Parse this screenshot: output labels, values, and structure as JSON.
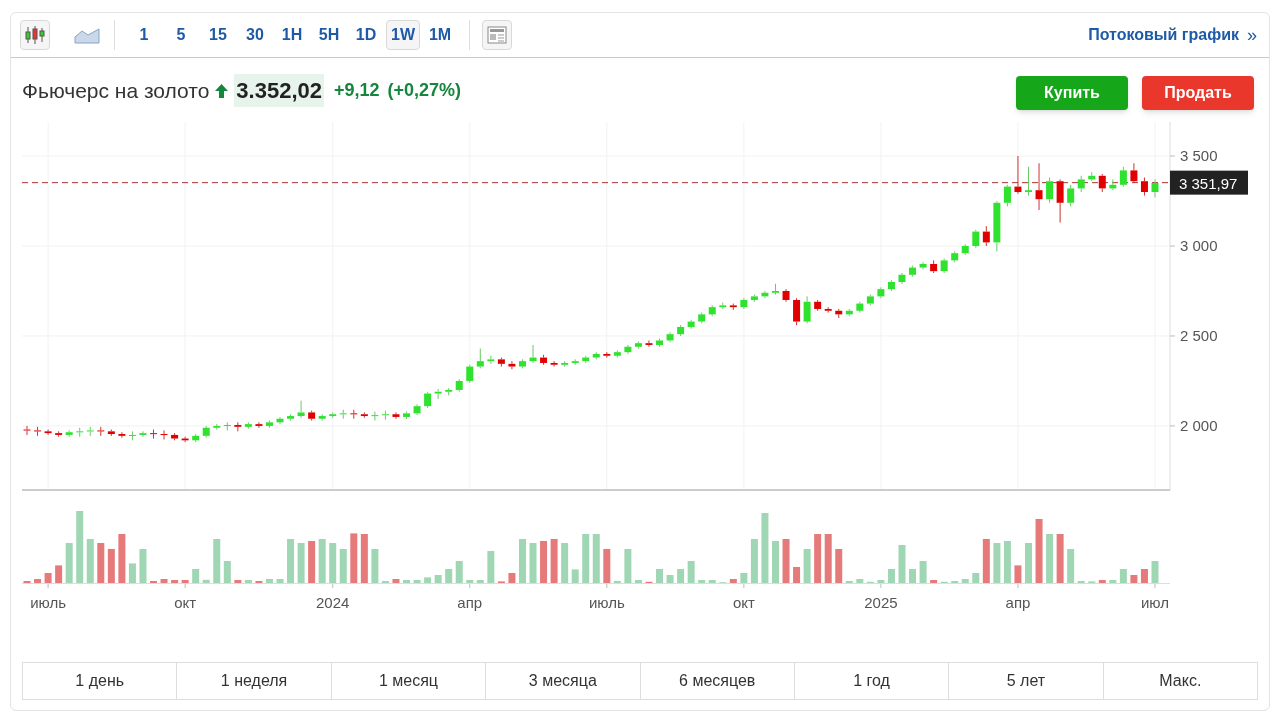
{
  "toolbar": {
    "chart_types": [
      {
        "kind": "candles",
        "selected": true
      },
      {
        "kind": "area",
        "selected": false
      }
    ],
    "intervals": [
      {
        "label": "1",
        "selected": false
      },
      {
        "label": "5",
        "selected": false
      },
      {
        "label": "15",
        "selected": false
      },
      {
        "label": "30",
        "selected": false
      },
      {
        "label": "1H",
        "selected": false
      },
      {
        "label": "5H",
        "selected": false
      },
      {
        "label": "1D",
        "selected": false
      },
      {
        "label": "1W",
        "selected": true
      },
      {
        "label": "1M",
        "selected": false
      }
    ],
    "streaming_link": {
      "label": "Потоковый график",
      "chevron": "»"
    }
  },
  "quote": {
    "name": "Фьючерс на золото",
    "rising": true,
    "price": "3.352,02",
    "change": "+9,12",
    "change_pct": "(+0,27%)"
  },
  "actions": [
    {
      "kind": "buy",
      "label": "Купить"
    },
    {
      "kind": "sell",
      "label": "Продать"
    }
  ],
  "chart": {
    "chart_data": {
      "type": "candlestick",
      "grid": true,
      "ylim": [
        1644,
        3689
      ],
      "yticks": [
        {
          "value": 2000,
          "label": "2 000"
        },
        {
          "value": 2500,
          "label": "2 500"
        },
        {
          "value": 3000,
          "label": "3 000"
        },
        {
          "value": 3500,
          "label": "3 500"
        }
      ],
      "categories": [
        null,
        null,
        "июль",
        null,
        null,
        null,
        null,
        null,
        null,
        null,
        null,
        null,
        null,
        null,
        null,
        "окт",
        null,
        null,
        null,
        null,
        null,
        null,
        null,
        null,
        null,
        null,
        null,
        null,
        null,
        "2024",
        null,
        null,
        null,
        null,
        null,
        null,
        null,
        null,
        null,
        null,
        null,
        null,
        "апр",
        null,
        null,
        null,
        null,
        null,
        null,
        null,
        null,
        null,
        null,
        null,
        null,
        "июль",
        null,
        null,
        null,
        null,
        null,
        null,
        null,
        null,
        null,
        null,
        null,
        null,
        "окт",
        null,
        null,
        null,
        null,
        null,
        null,
        null,
        null,
        null,
        null,
        null,
        null,
        "2025",
        null,
        null,
        null,
        null,
        null,
        null,
        null,
        null,
        null,
        null,
        null,
        null,
        "апр",
        null,
        null,
        null,
        null,
        null,
        null,
        null,
        null,
        null,
        null,
        null,
        null,
        "июл"
      ],
      "ref_lines": [
        {
          "axis": "y",
          "value": 3351.97,
          "color": "#aa3333",
          "label": "3 351,97"
        }
      ],
      "ohlc": [
        [
          1980,
          2000,
          1950,
          1975
        ],
        [
          1975,
          1995,
          1945,
          1970
        ],
        [
          1970,
          1980,
          1950,
          1960
        ],
        [
          1960,
          1970,
          1940,
          1950
        ],
        [
          1950,
          1975,
          1940,
          1965
        ],
        [
          1965,
          1990,
          1940,
          1970
        ],
        [
          1970,
          1995,
          1945,
          1975
        ],
        [
          1975,
          1995,
          1945,
          1970
        ],
        [
          1970,
          1980,
          1945,
          1955
        ],
        [
          1955,
          1965,
          1935,
          1945
        ],
        [
          1945,
          1970,
          1920,
          1950
        ],
        [
          1950,
          1970,
          1940,
          1960
        ],
        [
          1960,
          1980,
          1930,
          1955
        ],
        [
          1955,
          1975,
          1925,
          1950
        ],
        [
          1950,
          1960,
          1920,
          1930
        ],
        [
          1930,
          1940,
          1910,
          1920
        ],
        [
          1920,
          1955,
          1910,
          1945
        ],
        [
          1945,
          2000,
          1935,
          1990
        ],
        [
          1990,
          2010,
          1980,
          2000
        ],
        [
          2000,
          2020,
          1975,
          2005
        ],
        [
          2005,
          2020,
          1970,
          1995
        ],
        [
          1995,
          2020,
          1985,
          2010
        ],
        [
          2010,
          2020,
          1990,
          2000
        ],
        [
          2000,
          2030,
          1990,
          2020
        ],
        [
          2020,
          2050,
          2010,
          2040
        ],
        [
          2040,
          2065,
          2030,
          2055
        ],
        [
          2055,
          2140,
          2045,
          2075
        ],
        [
          2075,
          2085,
          2030,
          2040
        ],
        [
          2040,
          2065,
          2030,
          2055
        ],
        [
          2055,
          2075,
          2045,
          2065
        ],
        [
          2065,
          2090,
          2040,
          2070
        ],
        [
          2070,
          2090,
          2040,
          2065
        ],
        [
          2065,
          2075,
          2045,
          2055
        ],
        [
          2055,
          2080,
          2030,
          2060
        ],
        [
          2060,
          2085,
          2035,
          2065
        ],
        [
          2065,
          2075,
          2040,
          2050
        ],
        [
          2050,
          2080,
          2040,
          2070
        ],
        [
          2070,
          2120,
          2060,
          2110
        ],
        [
          2110,
          2190,
          2100,
          2180
        ],
        [
          2180,
          2205,
          2150,
          2190
        ],
        [
          2190,
          2210,
          2170,
          2200
        ],
        [
          2200,
          2260,
          2190,
          2250
        ],
        [
          2250,
          2340,
          2240,
          2330
        ],
        [
          2330,
          2430,
          2320,
          2360
        ],
        [
          2360,
          2390,
          2345,
          2370
        ],
        [
          2370,
          2380,
          2330,
          2345
        ],
        [
          2345,
          2360,
          2315,
          2330
        ],
        [
          2330,
          2370,
          2320,
          2360
        ],
        [
          2360,
          2450,
          2350,
          2380
        ],
        [
          2380,
          2395,
          2340,
          2350
        ],
        [
          2350,
          2360,
          2330,
          2340
        ],
        [
          2340,
          2360,
          2330,
          2350
        ],
        [
          2350,
          2370,
          2340,
          2360
        ],
        [
          2360,
          2390,
          2350,
          2380
        ],
        [
          2380,
          2410,
          2370,
          2400
        ],
        [
          2400,
          2410,
          2380,
          2390
        ],
        [
          2390,
          2420,
          2380,
          2410
        ],
        [
          2410,
          2450,
          2400,
          2440
        ],
        [
          2440,
          2470,
          2430,
          2460
        ],
        [
          2460,
          2475,
          2440,
          2450
        ],
        [
          2450,
          2485,
          2440,
          2475
        ],
        [
          2475,
          2520,
          2465,
          2510
        ],
        [
          2510,
          2560,
          2500,
          2550
        ],
        [
          2550,
          2590,
          2540,
          2580
        ],
        [
          2580,
          2630,
          2570,
          2620
        ],
        [
          2620,
          2670,
          2610,
          2660
        ],
        [
          2660,
          2685,
          2650,
          2670
        ],
        [
          2670,
          2680,
          2645,
          2660
        ],
        [
          2660,
          2710,
          2650,
          2700
        ],
        [
          2700,
          2730,
          2690,
          2720
        ],
        [
          2720,
          2750,
          2710,
          2740
        ],
        [
          2740,
          2790,
          2730,
          2750
        ],
        [
          2750,
          2760,
          2690,
          2700
        ],
        [
          2700,
          2710,
          2560,
          2580
        ],
        [
          2580,
          2720,
          2570,
          2690
        ],
        [
          2690,
          2700,
          2640,
          2650
        ],
        [
          2650,
          2660,
          2630,
          2640
        ],
        [
          2640,
          2650,
          2600,
          2620
        ],
        [
          2620,
          2650,
          2610,
          2640
        ],
        [
          2640,
          2690,
          2630,
          2680
        ],
        [
          2680,
          2730,
          2670,
          2720
        ],
        [
          2720,
          2770,
          2710,
          2760
        ],
        [
          2760,
          2810,
          2750,
          2800
        ],
        [
          2800,
          2850,
          2790,
          2840
        ],
        [
          2840,
          2890,
          2830,
          2880
        ],
        [
          2880,
          2910,
          2870,
          2900
        ],
        [
          2900,
          2920,
          2850,
          2860
        ],
        [
          2860,
          2930,
          2850,
          2920
        ],
        [
          2920,
          2970,
          2910,
          2960
        ],
        [
          2960,
          3010,
          2950,
          3000
        ],
        [
          3000,
          3090,
          2990,
          3080
        ],
        [
          3080,
          3110,
          3000,
          3020
        ],
        [
          3020,
          3250,
          2970,
          3240
        ],
        [
          3240,
          3340,
          3220,
          3330
        ],
        [
          3330,
          3500,
          3290,
          3300
        ],
        [
          3300,
          3440,
          3280,
          3310
        ],
        [
          3310,
          3460,
          3200,
          3260
        ],
        [
          3260,
          3380,
          3240,
          3360
        ],
        [
          3360,
          3370,
          3130,
          3240
        ],
        [
          3240,
          3340,
          3220,
          3320
        ],
        [
          3320,
          3390,
          3300,
          3370
        ],
        [
          3370,
          3410,
          3360,
          3390
        ],
        [
          3390,
          3400,
          3300,
          3320
        ],
        [
          3320,
          3370,
          3310,
          3340
        ],
        [
          3340,
          3440,
          3330,
          3420
        ],
        [
          3420,
          3460,
          3350,
          3360
        ],
        [
          3360,
          3380,
          3280,
          3300
        ],
        [
          3300,
          3370,
          3270,
          3350
        ]
      ]
    }
  },
  "ranges": [
    "1 день",
    "1 неделя",
    "1 месяц",
    "3 месяца",
    "6 месяцев",
    "1 год",
    "5 лет",
    "Макс."
  ]
}
